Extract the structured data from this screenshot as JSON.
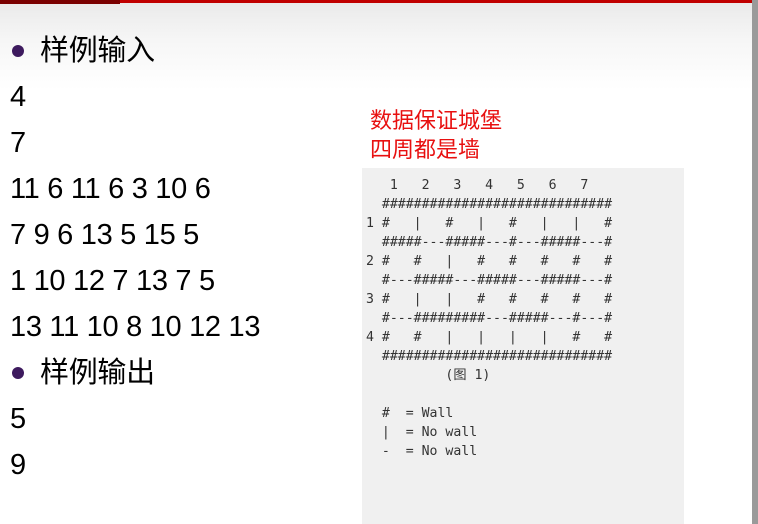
{
  "sample_input": {
    "heading": "样例输入",
    "lines": [
      "4",
      "7",
      "11 6 11 6 3 10 6",
      "7 9 6 13 5 15 5",
      "1 10 12 7 13 7 5",
      "13 11 10 8 10 12 13"
    ]
  },
  "sample_output": {
    "heading": "样例输出",
    "lines": [
      "5",
      "9"
    ]
  },
  "note": {
    "line1": "数据保证城堡",
    "line2": "四周都是墙"
  },
  "figure": {
    "lines": [
      "   1   2   3   4   5   6   7",
      "  #############################",
      "1 #   |   #   |   #   |   |   #",
      "  #####---#####---#---#####---#",
      "2 #   #   |   #   #   #   #   #",
      "  #---#####---#####---#####---#",
      "3 #   |   |   #   #   #   #   #",
      "  #---#########---#####---#---#",
      "4 #   #   |   |   |   |   #   #",
      "  #############################",
      "          (图 1)",
      "",
      "  #  = Wall",
      "  |  = No wall",
      "  -  = No wall"
    ]
  },
  "colors": {
    "note_red": "#e81010",
    "bullet": "#3d1a5e",
    "top_bar": "#c00000"
  }
}
